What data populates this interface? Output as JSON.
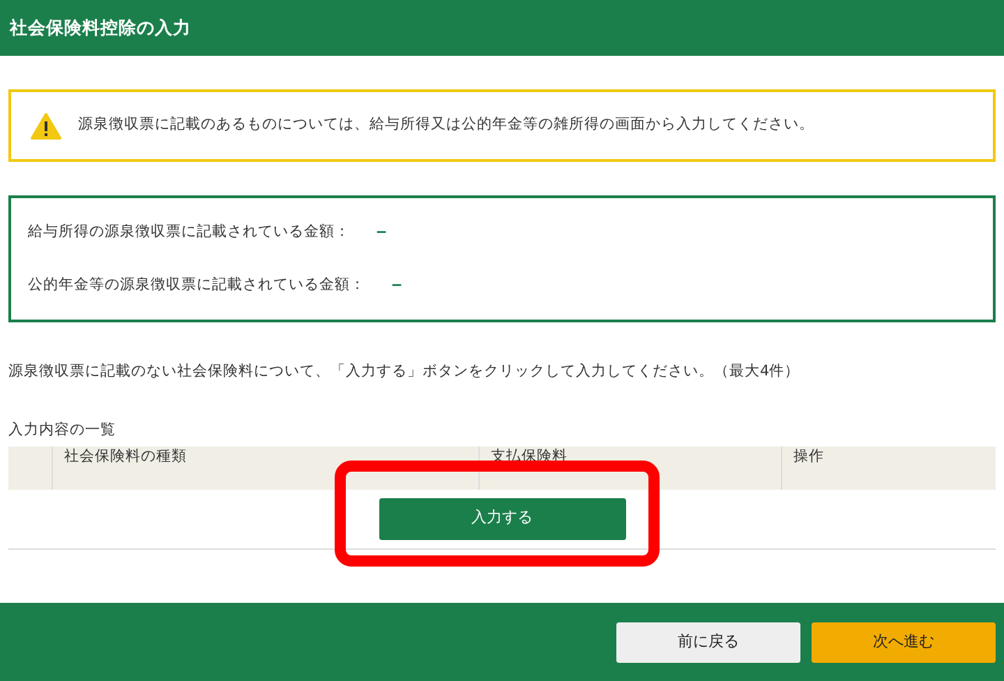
{
  "header": {
    "title": "社会保険料控除の入力"
  },
  "warning": {
    "text": "源泉徴収票に記載のあるものについては、給与所得又は公的年金等の雑所得の画面から入力してください。"
  },
  "amounts": [
    {
      "label": "給与所得の源泉徴収票に記載されている金額：",
      "value": "－"
    },
    {
      "label": "公的年金等の源泉徴収票に記載されている金額：",
      "value": "－"
    }
  ],
  "instruction": "源泉徴収票に記載のない社会保険料について、「入力する」ボタンをクリックして入力してください。（最大4件）",
  "list": {
    "title": "入力内容の一覧",
    "columns": [
      "社会保険料の種類",
      "支払保険料",
      "操作"
    ],
    "add_button": "入力する"
  },
  "footer": {
    "buttons": [
      {
        "label": "前に戻る",
        "kind": "back"
      },
      {
        "label": "次へ進む",
        "kind": "next"
      }
    ]
  }
}
